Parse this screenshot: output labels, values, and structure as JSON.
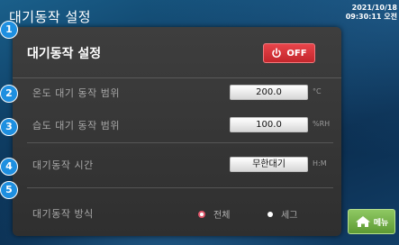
{
  "header": {
    "title": "대기동작 설정",
    "date": "2021/10/18",
    "time": "09:30:11 오전"
  },
  "panel": {
    "title": "대기동작 설정",
    "power": {
      "label": "OFF",
      "state": "off"
    }
  },
  "callouts": [
    "1",
    "2",
    "3",
    "4",
    "5"
  ],
  "rows": [
    {
      "label": "온도 대기 동작 범위",
      "value": "200.0",
      "unit": "°C"
    },
    {
      "label": "습도 대기 동작 범위",
      "value": "100.0",
      "unit": "%RH"
    },
    {
      "label": "대기동작 시간",
      "value": "무한대기",
      "unit": "H:M"
    }
  ],
  "mode": {
    "label": "대기동작 방식",
    "options": [
      {
        "label": "전체",
        "selected": true
      },
      {
        "label": "세그",
        "selected": false
      }
    ]
  },
  "menu_button": {
    "label": "메뉴",
    "icon": "home-icon"
  },
  "colors": {
    "power_red": "#d8333a",
    "callout_blue": "#1e8fe0",
    "menu_green": "#6fae44",
    "radio_selected": "#e0566a"
  }
}
